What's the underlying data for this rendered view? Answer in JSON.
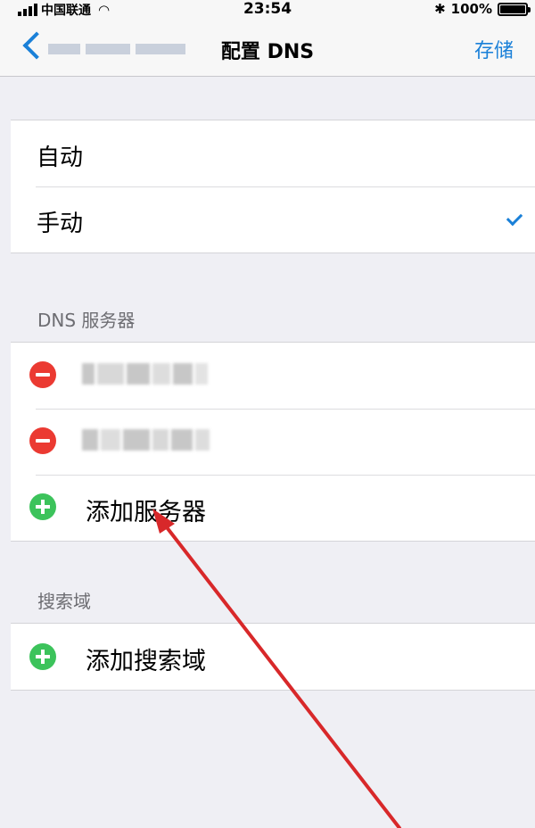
{
  "status_bar": {
    "carrier": "中国联通",
    "time": "23:54",
    "battery": "100%",
    "battery_level": 1.0
  },
  "nav": {
    "title": "配置 DNS",
    "save_label": "存储"
  },
  "config_section": {
    "items": [
      {
        "label": "自动",
        "selected": false
      },
      {
        "label": "手动",
        "selected": true
      }
    ]
  },
  "dns_section": {
    "header": "DNS 服务器",
    "add_label": "添加服务器"
  },
  "search_section": {
    "header": "搜索域",
    "add_label": "添加搜索域"
  },
  "colors": {
    "accent": "#1a80d8",
    "delete": "#eb3a32",
    "add": "#3cc35b",
    "annotation_arrow": "#d8282a"
  }
}
